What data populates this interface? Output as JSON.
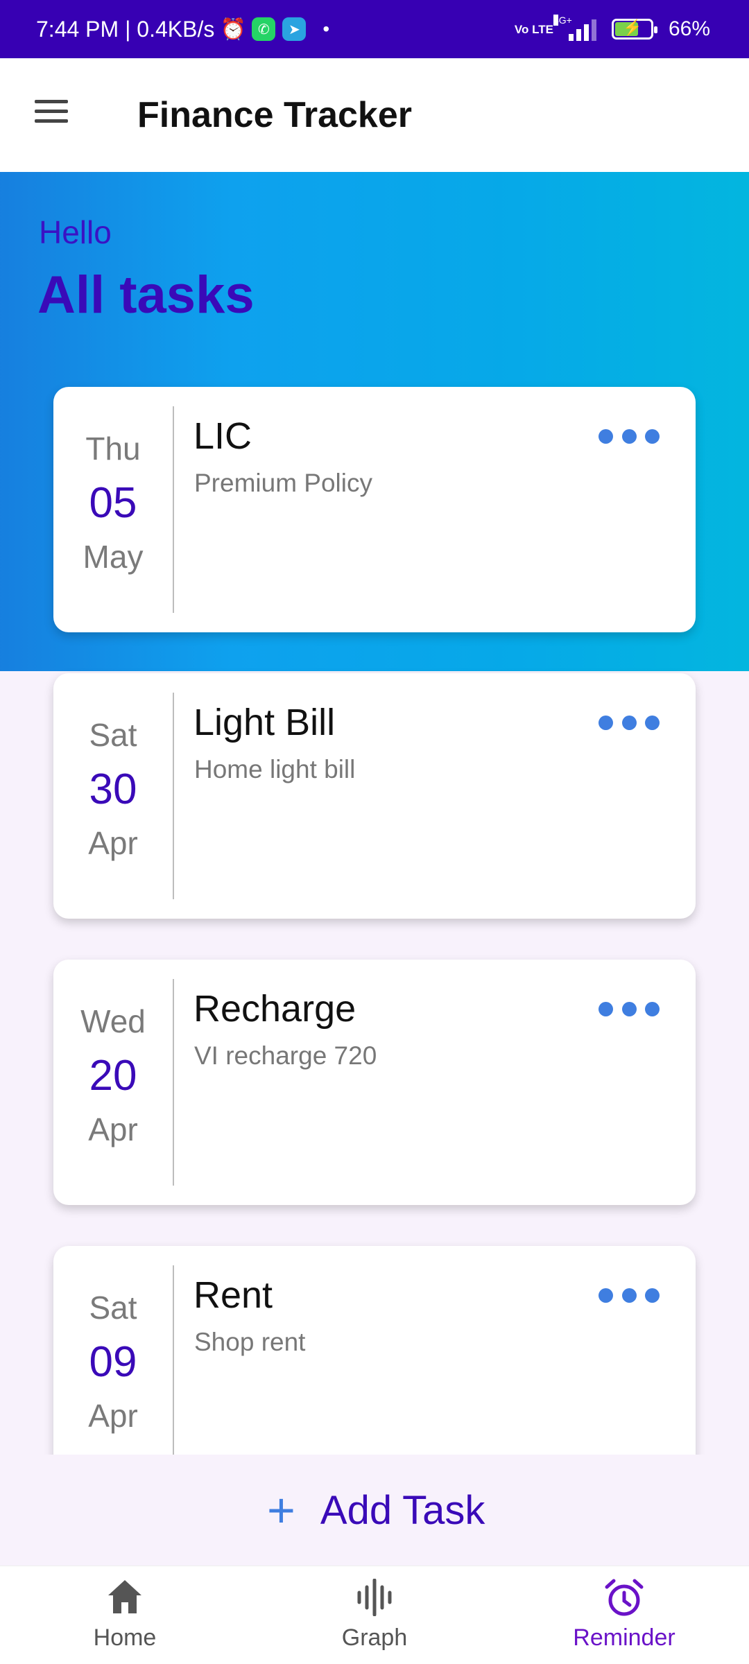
{
  "status_bar": {
    "time_speed": "7:44 PM | 0.4KB/s",
    "volte": "Vo LTE",
    "network": "4G+",
    "battery_percent": "66%",
    "battery_level": 0.66
  },
  "app_bar": {
    "title": "Finance Tracker"
  },
  "header": {
    "greeting": "Hello",
    "heading": "All tasks"
  },
  "tasks": [
    {
      "dow": "Thu",
      "day": "05",
      "month": "May",
      "title": "LIC",
      "subtitle": "Premium Policy"
    },
    {
      "dow": "Sat",
      "day": "30",
      "month": "Apr",
      "title": "Light Bill",
      "subtitle": "Home light bill"
    },
    {
      "dow": "Wed",
      "day": "20",
      "month": "Apr",
      "title": "Recharge",
      "subtitle": "VI recharge 720"
    },
    {
      "dow": "Sat",
      "day": "09",
      "month": "Apr",
      "title": "Rent",
      "subtitle": "Shop rent"
    }
  ],
  "add_task": {
    "label": "Add Task"
  },
  "bottom_nav": [
    {
      "label": "Home",
      "icon": "home-icon",
      "active": false
    },
    {
      "label": "Graph",
      "icon": "graph-icon",
      "active": false
    },
    {
      "label": "Reminder",
      "icon": "alarm-clock-icon",
      "active": true
    }
  ],
  "colors": {
    "status_bar": "#3700b3",
    "accent_purple": "#3a0ab8",
    "accent_blue": "#3f7ee0",
    "nav_active": "#6a12c8"
  }
}
